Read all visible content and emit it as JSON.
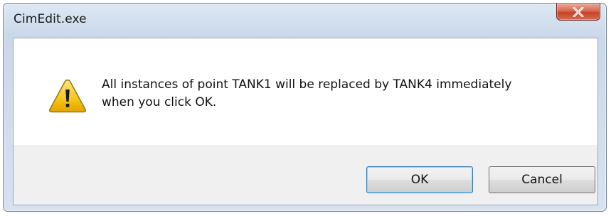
{
  "window": {
    "title": "CimEdit.exe",
    "close_icon": "close-icon"
  },
  "dialog": {
    "icon": "warning-icon",
    "message_line1": "All instances of point TANK1 will be replaced by TANK4 immediately",
    "message_line2": "when you click OK."
  },
  "buttons": {
    "ok_label": "OK",
    "cancel_label": "Cancel"
  },
  "colors": {
    "close_button": "#c7442a",
    "warning_fill": "#f5c518",
    "default_button_border": "#3c7fb1"
  }
}
